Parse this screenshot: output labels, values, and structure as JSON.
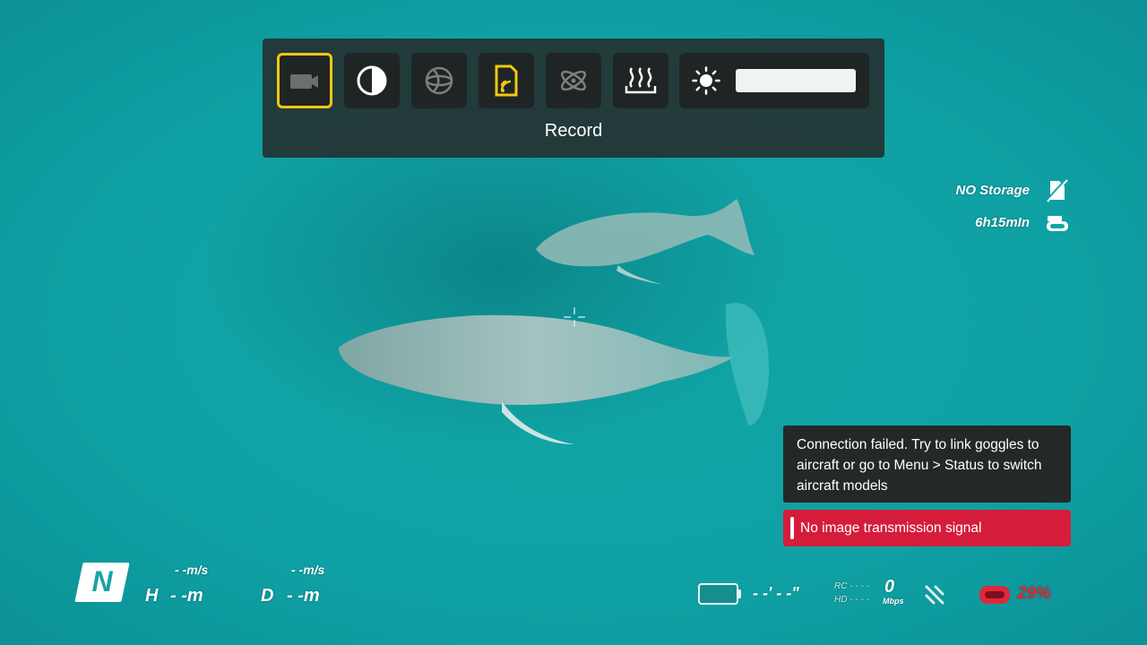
{
  "quick_menu": {
    "label": "Record",
    "buttons": [
      {
        "name": "record-mode",
        "icon": "video-camera-icon",
        "selected": true
      },
      {
        "name": "color-mode",
        "icon": "contrast-icon",
        "selected": false
      },
      {
        "name": "gimbal",
        "icon": "gimbal-sphere-icon",
        "selected": false
      },
      {
        "name": "storage",
        "icon": "sd-card-icon",
        "selected": false
      },
      {
        "name": "signal",
        "icon": "antenna-atom-icon",
        "selected": false
      },
      {
        "name": "fan",
        "icon": "heat-icon",
        "selected": false
      }
    ],
    "brightness": {
      "icon": "sun-icon",
      "level": 1.0
    }
  },
  "status": {
    "storage_text": "NO Storage",
    "storage_icon": "no-storage-icon",
    "time_text": "6h15mIn",
    "time_icon": "goggles-icon"
  },
  "toasts": {
    "connection_failed": "Connection failed. Try to link goggles to aircraft or go to Menu > Status to switch aircraft models",
    "connection_failed_lines": [
      "Connection failed. Try to link goggles to",
      "aircraft or go to Menu > Status to switch",
      "aircraft models"
    ],
    "no_signal": "No image transmission signal"
  },
  "hud": {
    "mode": "N",
    "h_speed": "- -m/s",
    "h_label": "H",
    "h_value": "- -m",
    "d_speed": "- -m/s",
    "d_label": "D",
    "d_value": "- -m",
    "flight_time": "- -' - -\"",
    "rc_label": "RC",
    "rc_value": "- - - -",
    "hd_label": "HD",
    "hd_value": "- - - -",
    "bitrate_value": "0",
    "bitrate_unit": "Mbps",
    "goggles_battery": "29%",
    "colors": {
      "accent": "#f2c811",
      "warning": "#d51d3b",
      "hud_red": "#e3263a"
    }
  }
}
